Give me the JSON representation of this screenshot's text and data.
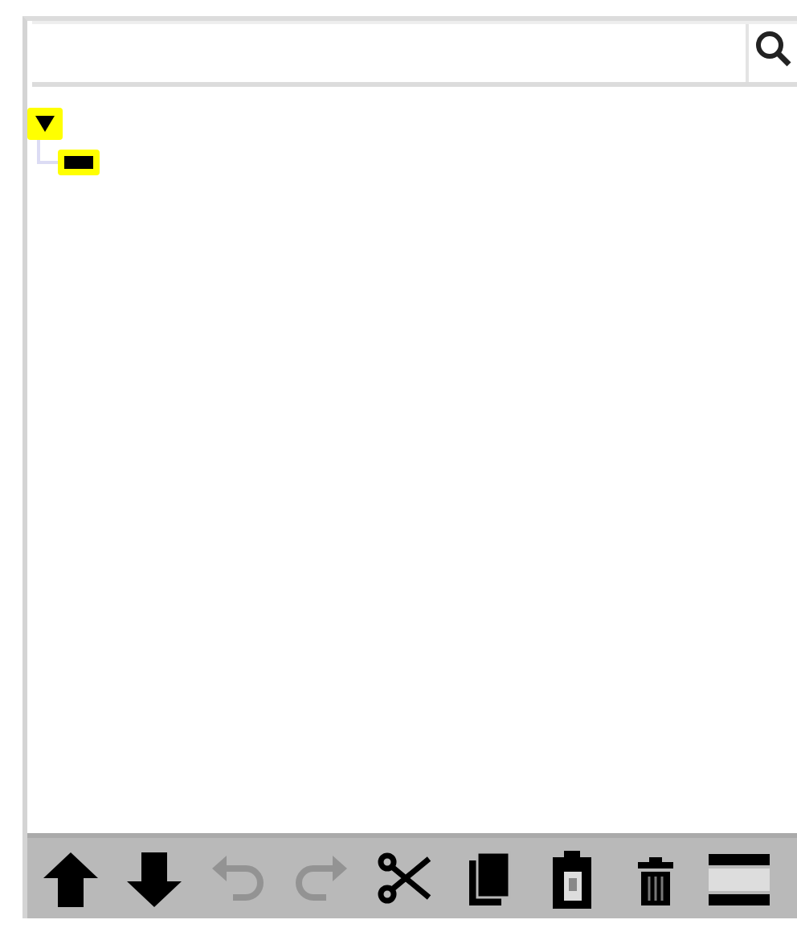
{
  "search": {
    "kind": "search"
  },
  "tree": [
    {
      "kind": "toggle",
      "expanded": true,
      "children": [
        {
          "kind": "leaf"
        }
      ]
    }
  ],
  "toolbar": [
    {
      "kind": "up",
      "disabled": false
    },
    {
      "kind": "down",
      "disabled": false
    },
    {
      "kind": "undo",
      "disabled": true
    },
    {
      "kind": "redo",
      "disabled": true
    },
    {
      "kind": "cut",
      "disabled": false
    },
    {
      "kind": "copy",
      "disabled": false
    },
    {
      "kind": "paste",
      "disabled": false
    },
    {
      "kind": "delete",
      "disabled": false
    },
    {
      "kind": "separator",
      "disabled": false
    }
  ]
}
